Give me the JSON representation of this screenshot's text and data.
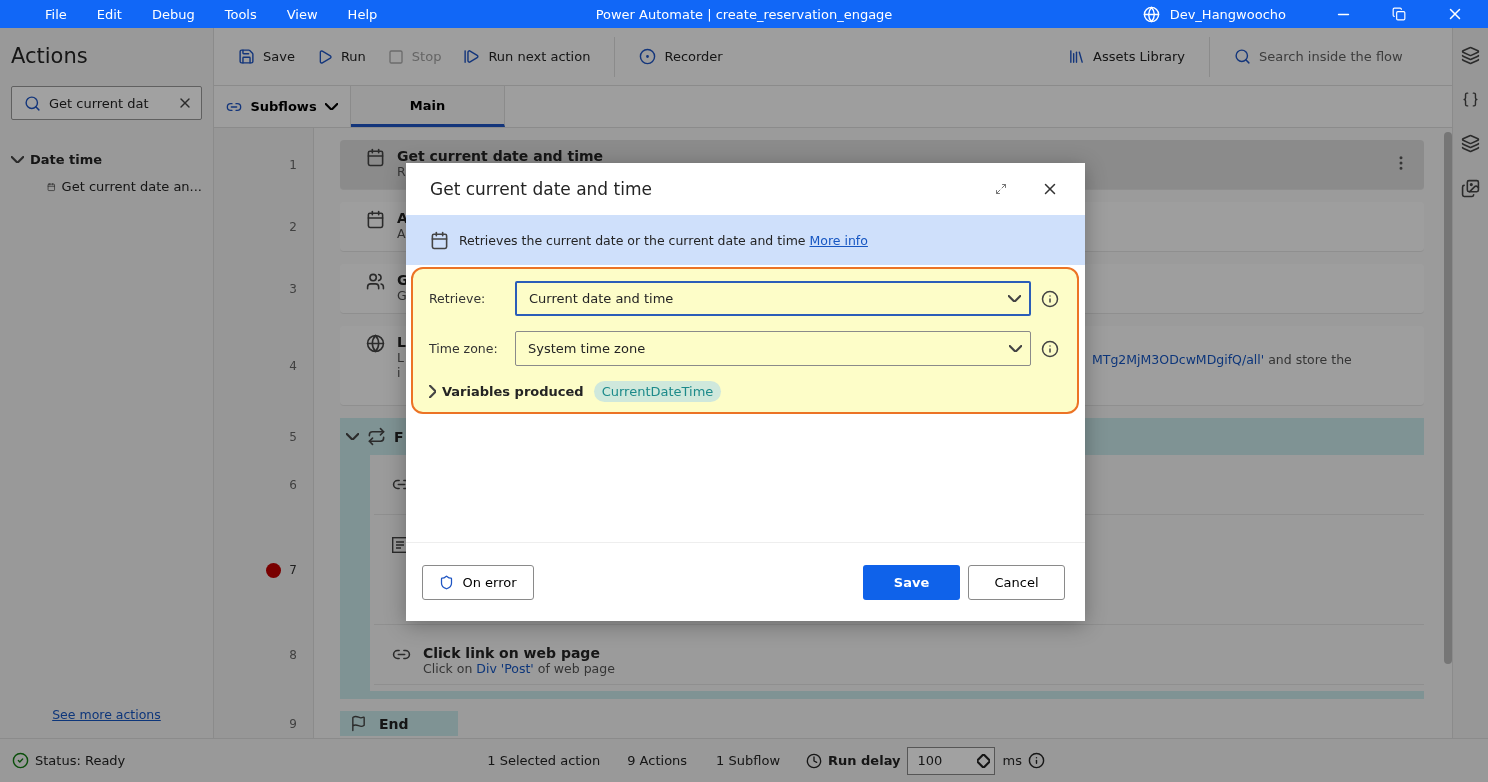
{
  "menu": [
    "File",
    "Edit",
    "Debug",
    "Tools",
    "View",
    "Help"
  ],
  "window": {
    "title": "Power Automate | create_reservation_engage",
    "user": "Dev_Hangwoocho"
  },
  "actions_panel": {
    "title": "Actions",
    "search": {
      "value": "Get current dat"
    },
    "see_more": "See more actions",
    "tree": [
      {
        "label": "Date time",
        "expanded": true,
        "children": [
          {
            "label": "Get current date an..."
          }
        ]
      }
    ]
  },
  "toolbar": [
    {
      "kind": "save",
      "label": "Save",
      "disabled": false
    },
    {
      "kind": "run",
      "label": "Run",
      "disabled": false
    },
    {
      "kind": "stop",
      "label": "Stop",
      "disabled": true
    },
    {
      "kind": "next",
      "label": "Run next action",
      "disabled": false
    },
    {
      "kind": "recorder",
      "label": "Recorder",
      "disabled": false
    }
  ],
  "assets": "Assets Library",
  "flow_search": {
    "placeholder": "Search inside the flow"
  },
  "subflows": "Subflows",
  "tabs": [
    {
      "label": "Main",
      "selected": true
    }
  ],
  "flow": [
    {
      "kind": "date",
      "number": "1",
      "title": "Get current date and time",
      "description": "R",
      "selected": true,
      "breakpoint": false
    },
    {
      "kind": "date",
      "number": "2",
      "title": "A",
      "description": "A",
      "selected": false,
      "breakpoint": false
    },
    {
      "kind": "email",
      "number": "3",
      "title": "G",
      "description": "G",
      "selected": false,
      "breakpoint": false
    },
    {
      "kind": "web",
      "number": "4",
      "title": "L",
      "description": "L",
      "tail_link": "MTg2MjM3ODcwMDgifQ/all'",
      "tail_text": " and store the",
      "description_2": "i",
      "selected": false,
      "breakpoint": false
    },
    {
      "kind": "loop",
      "number": "5",
      "title": "F",
      "expanded": true,
      "breakpoint": false,
      "children": [
        {
          "kind": "link",
          "number": "6",
          "breakpoint": false
        },
        {
          "kind": "text",
          "number": "7",
          "breakpoint": true
        },
        {
          "kind": "link",
          "number": "8",
          "title": "Click link on web page",
          "description": "Click on ",
          "description_link": "Div 'Post'",
          "description_end": " of web page",
          "breakpoint": false
        }
      ]
    },
    {
      "kind": "end",
      "number": "9",
      "title": "End",
      "breakpoint": false
    }
  ],
  "dialog": {
    "title": "Get current date and time",
    "info": "Retrieves the current date or the current date and time",
    "info_link": "More info",
    "fields": [
      {
        "label": "Retrieve:",
        "value": "Current date and time",
        "focused": true
      },
      {
        "label": "Time zone:",
        "value": "System time zone",
        "focused": false
      }
    ],
    "variables_label": "Variables produced",
    "variables": [
      "CurrentDateTime"
    ],
    "on_error": "On error",
    "save": "Save",
    "cancel": "Cancel"
  },
  "status_bar": {
    "status": "Status: Ready",
    "selected": "1 Selected action",
    "actions": "9 Actions",
    "subflows": "1 Subflow",
    "run_delay_label": "Run delay",
    "run_delay": "100",
    "unit": "ms"
  }
}
